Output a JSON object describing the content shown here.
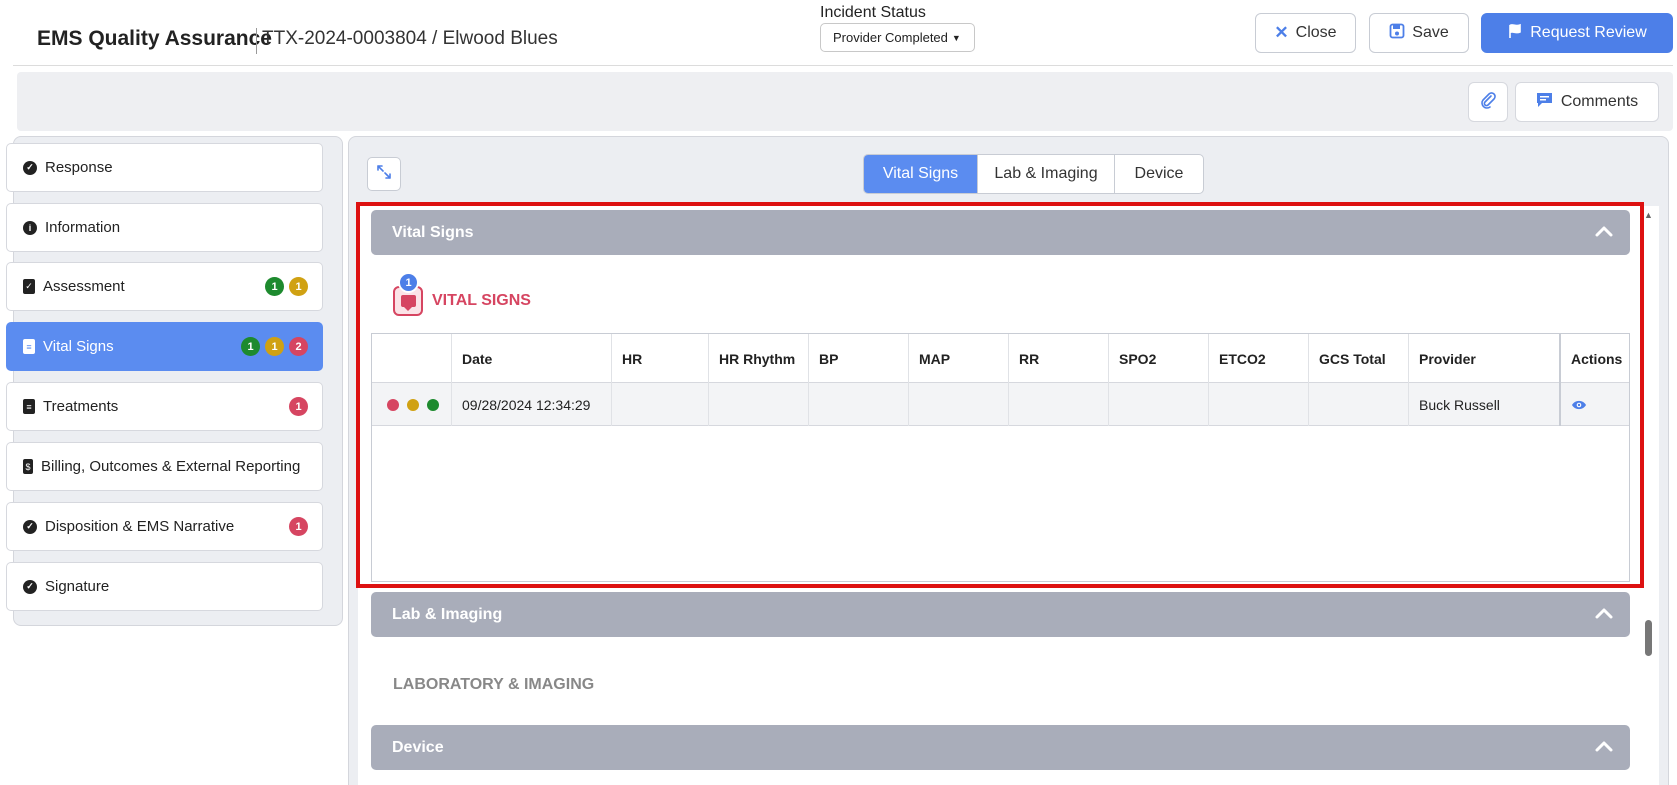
{
  "header": {
    "app_title": "EMS Quality Assurance",
    "record_title": "TTX-2024-0003804 / Elwood Blues",
    "status_label": "Incident Status",
    "status_value": "Provider Completed",
    "close_label": "Close",
    "save_label": "Save",
    "request_review_label": "Request Review"
  },
  "toolbar": {
    "comments_label": "Comments"
  },
  "sidebar": {
    "items": [
      {
        "label": "Response",
        "icon": "check-circle-icon"
      },
      {
        "label": "Information",
        "icon": "info-circle-icon"
      },
      {
        "label": "Assessment",
        "icon": "clipboard-check-icon",
        "badges": [
          "1",
          "1"
        ]
      },
      {
        "label": "Vital Signs",
        "icon": "document-icon",
        "badges": [
          "1",
          "1",
          "2"
        ],
        "active": true
      },
      {
        "label": "Treatments",
        "icon": "document-icon",
        "badges": [
          "1"
        ]
      },
      {
        "label": "Billing, Outcomes & External Reporting",
        "icon": "billing-document-icon"
      },
      {
        "label": "Disposition & EMS Narrative",
        "icon": "check-circle-icon",
        "badges": [
          "1"
        ]
      },
      {
        "label": "Signature",
        "icon": "check-circle-icon"
      }
    ]
  },
  "tabs": [
    {
      "label": "Vital Signs",
      "active": true
    },
    {
      "label": "Lab & Imaging"
    },
    {
      "label": "Device"
    }
  ],
  "sections": {
    "vital_signs_bar": "Vital Signs",
    "vital_signs_heading": "VITAL SIGNS",
    "vital_signs_comment_count": "1",
    "lab_bar": "Lab & Imaging",
    "lab_heading": "LABORATORY & IMAGING",
    "device_bar": "Device"
  },
  "table": {
    "columns": [
      "",
      "Date",
      "HR",
      "HR Rhythm",
      "BP",
      "MAP",
      "RR",
      "SPO2",
      "ETCO2",
      "GCS Total",
      "Provider",
      "Actions"
    ],
    "rows": [
      {
        "date": "09/28/2024 12:34:29",
        "hr": "",
        "hr_rhythm": "",
        "bp": "",
        "map": "",
        "rr": "",
        "spo2": "",
        "etco2": "",
        "gcs_total": "",
        "provider": "Buck Russell"
      }
    ]
  },
  "colors": {
    "accent": "#4d7fe8",
    "active_sidebar": "#5b8cf0",
    "badge_green": "#1d8a2e",
    "badge_yellow": "#d0a112",
    "badge_red": "#d64561",
    "section_bar": "#a9adba",
    "highlight": "#dd1111"
  }
}
